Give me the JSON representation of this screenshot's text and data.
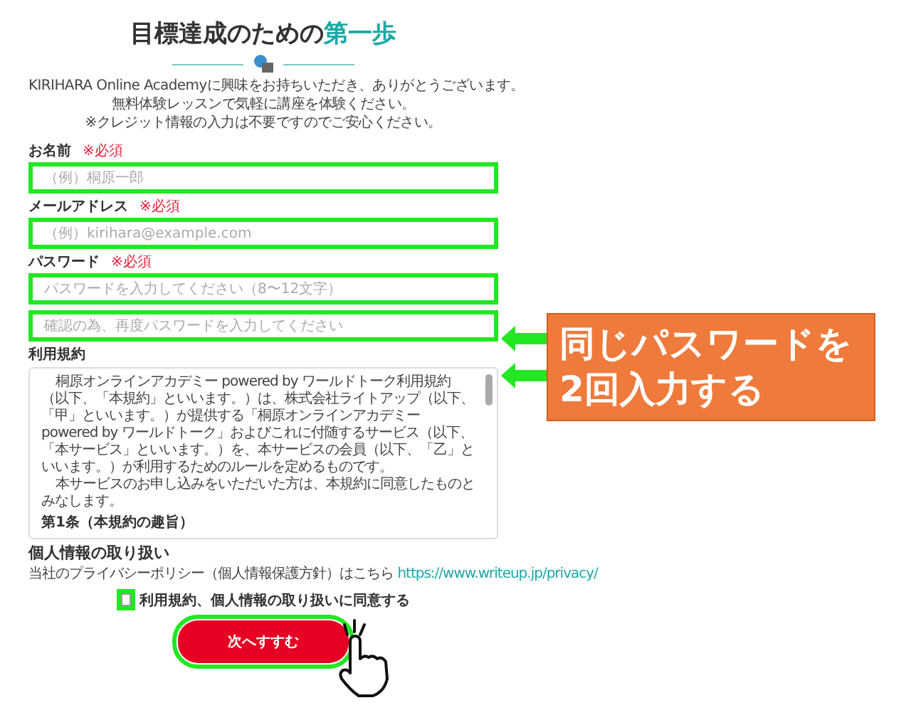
{
  "title": {
    "text": "目標達成のための",
    "accent": "第一歩"
  },
  "intro": [
    "KIRIHARA Online Academyに興味をお持ちいただき、ありがとうございます。",
    "無料体験レッスンで気軽に講座を体験ください。",
    "※クレジット情報の入力は不要ですのでご安心ください。"
  ],
  "fields": [
    {
      "label": "お名前",
      "required": "※必須",
      "placeholder": "（例）桐原一郎",
      "highlighted": true
    },
    {
      "label": "メールアドレス",
      "required": "※必須",
      "placeholder": "（例）kirihara@example.com",
      "highlighted": true
    },
    {
      "label": "パスワード",
      "required": "※必須",
      "placeholder": "パスワードを入力してください（8〜12文字）",
      "highlighted": true
    },
    {
      "placeholder": "確認の為、再度パスワードを入力してください",
      "highlighted": true
    }
  ],
  "terms": {
    "label": "利用規約",
    "paragraphs": [
      "桐原オンラインアカデミー powered by ワールドトーク利用規約（以下、「本規約」といいます。）は、株式会社ライトアップ（以下、「甲」といいます。）が提供する「桐原オンラインアカデミー powered by ワールドトーク」およびこれに付随するサービス（以下、「本サービス」といいます。）を、本サービスの会員（以下、「乙」といいます。）が利用するためのルールを定めるものです。",
      "本サービスのお申し込みをいただいた方は、本規約に同意したものとみなします。"
    ],
    "heading": "第1条（本規約の趣旨）"
  },
  "privacy": {
    "heading": "個人情報の取り扱い",
    "text": "当社のプライバシーポリシー（個人情報保護方針）はこちら",
    "link": "https://www.writeup.jp/privacy/"
  },
  "agree": {
    "label": "利用規約、個人情報の取り扱いに同意する",
    "checked": false,
    "highlighted": true
  },
  "submit": {
    "label": "次へすすむ",
    "highlighted": true
  },
  "callout": {
    "lines": [
      "同じパスワードを",
      "2回入力する"
    ]
  }
}
